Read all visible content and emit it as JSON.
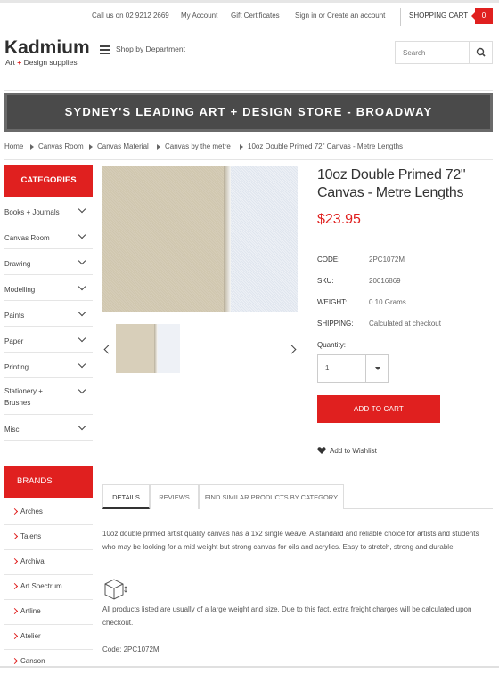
{
  "util_nav": {
    "call_us": "Call us on 02 9212 2669",
    "my_account": "My Account",
    "gift_certificates": "Gift Certificates",
    "sign_in": "Sign in or Create an account",
    "cart_label": "SHOPPING CART",
    "cart_count": "0"
  },
  "logo": {
    "main": "Kadmium",
    "sub_left": "Art",
    "sub_plus": "+",
    "sub_right": "Design supplies"
  },
  "shop_by_department": "Shop by Department",
  "search": {
    "placeholder": "Search"
  },
  "banner": "SYDNEY'S LEADING ART + DESIGN STORE - BROADWAY",
  "breadcrumb": [
    "Home",
    "Canvas Room",
    "Canvas Material",
    "Canvas by the metre",
    "10oz Double Primed 72\" Canvas - Metre Lengths"
  ],
  "categories": {
    "heading": "CATEGORIES",
    "items": [
      "Books + Journals",
      "Canvas Room",
      "Drawing",
      "Modelling",
      "Paints",
      "Paper",
      "Printing",
      "Stationery + Brushes",
      "Misc."
    ]
  },
  "brands": {
    "heading": "BRANDS",
    "items": [
      "Arches",
      "Talens",
      "Archival",
      "Art Spectrum",
      "Artline",
      "Atelier",
      "Canson"
    ]
  },
  "product": {
    "title": "10oz Double Primed 72\" Canvas - Metre Lengths",
    "price": "$23.95",
    "specs": [
      {
        "key": "CODE:",
        "value": "2PC1072M"
      },
      {
        "key": "SKU:",
        "value": "20016869"
      },
      {
        "key": "WEIGHT:",
        "value": "0.10 Grams"
      },
      {
        "key": "SHIPPING:",
        "value": "Calculated at checkout"
      }
    ],
    "quantity_label": "Quantity:",
    "quantity_value": "1",
    "add_to_cart": "ADD TO CART",
    "wishlist": "Add to Wishlist"
  },
  "tabs": [
    "DETAILS",
    "REVIEWS",
    "FIND SIMILAR PRODUCTS BY CATEGORY"
  ],
  "details": {
    "description": "10oz double primed artist quality canvas has a 1x2 single weave. A standard and reliable choice for artists and students who may be looking for a mid weight but strong canvas for oils and acrylics. Easy to stretch, strong and durable.",
    "freight_note": "All products listed are usually of a large weight and size. Due to this fact, extra freight charges will be calculated upon checkout.",
    "code_line": "Code: 2PC1072M"
  },
  "colors": {
    "accent": "#e0201f",
    "banner_bg": "#4a4a4a",
    "text": "#555555"
  },
  "icons": [
    "hamburger-icon",
    "search-icon",
    "chevron-right-icon",
    "chevron-down-icon",
    "heart-icon",
    "box-icon",
    "caret-down-icon"
  ]
}
